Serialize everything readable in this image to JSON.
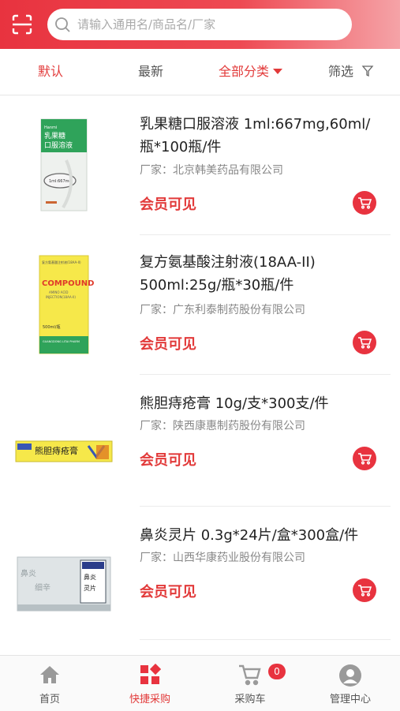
{
  "search": {
    "placeholder": "请输入通用名/商品名/厂家"
  },
  "filters": {
    "default": "默认",
    "latest": "最新",
    "category": "全部分类",
    "screen": "筛选"
  },
  "products": [
    {
      "name": "乳果糖口服溶液 1ml:667mg,60ml/瓶*100瓶/件",
      "maker": "厂家：北京韩美药品有限公司",
      "price_label": "会员可见",
      "box_text": "乳果糖口服溶液",
      "box_sub": "1ml:667mg"
    },
    {
      "name": "复方氨基酸注射液(18AA-II) 500ml:25g/瓶*30瓶/件",
      "maker": "厂家：广东利泰制药股份有限公司",
      "price_label": "会员可见",
      "box_text": "COMPOUND",
      "box_sub": "500ml/瓶"
    },
    {
      "name": "熊胆痔疮膏 10g/支*300支/件",
      "maker": "厂家：陕西康惠制药股份有限公司",
      "price_label": "会员可见",
      "box_text": "熊胆痔疮膏"
    },
    {
      "name": "鼻炎灵片 0.3g*24片/盒*300盒/件",
      "maker": "厂家：山西华康药业股份有限公司",
      "price_label": "会员可见",
      "box_text": "鼻炎灵片"
    }
  ],
  "tabbar": {
    "home": "首页",
    "quick": "快捷采购",
    "cart": "采购车",
    "cart_count": "0",
    "manage": "管理中心"
  },
  "colors": {
    "brand": "#e8333f",
    "box_green": "#2fa35a",
    "box_yellow": "#f6e84a",
    "box_blue": "#3a56b4"
  }
}
